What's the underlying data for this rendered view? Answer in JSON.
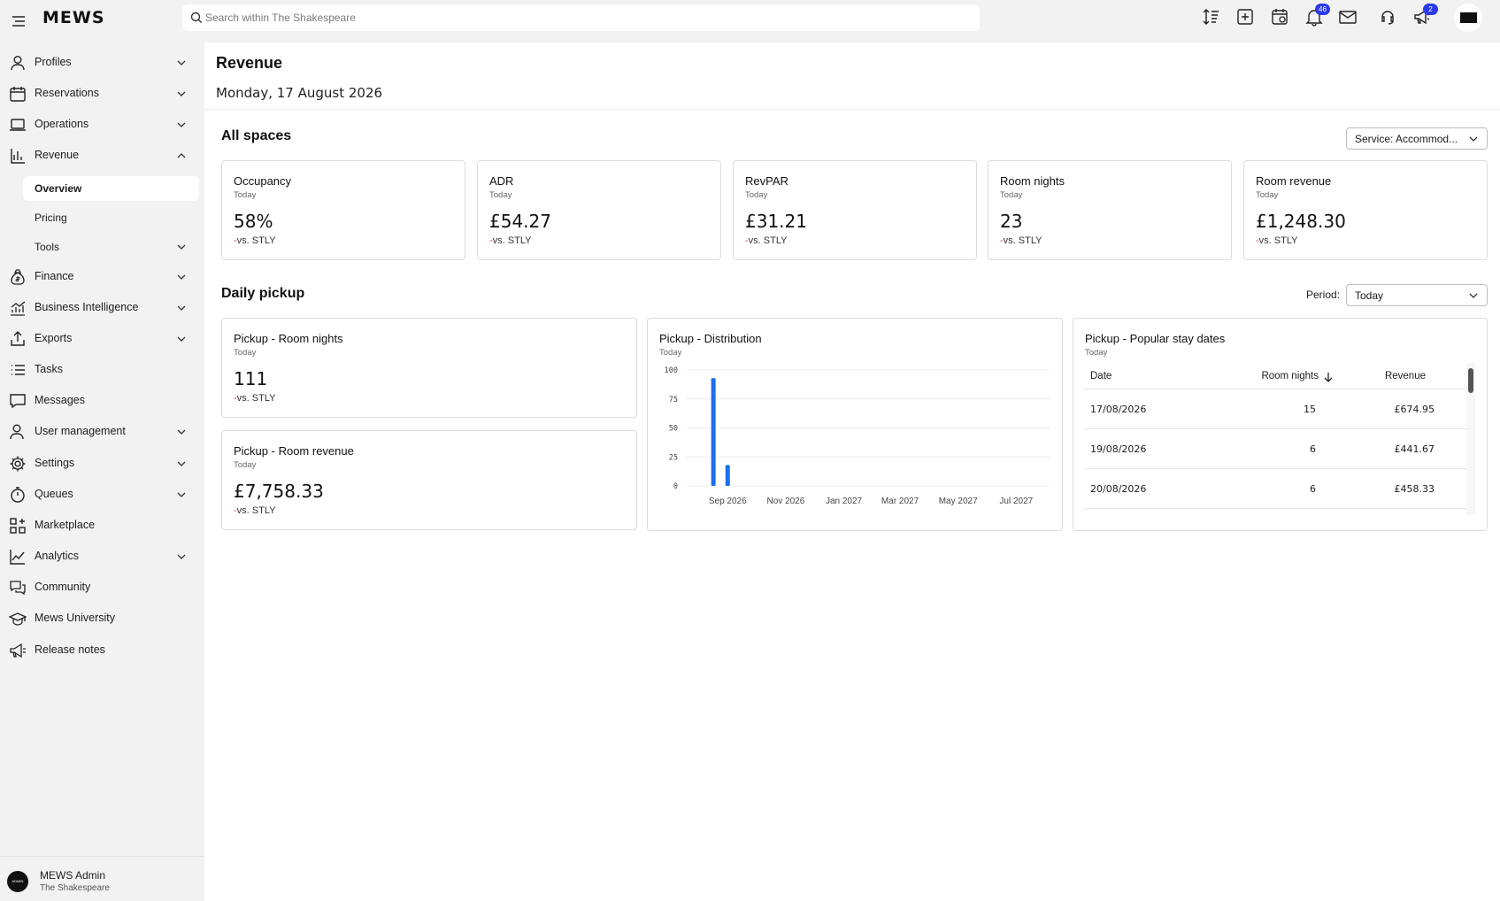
{
  "topbar": {
    "logo": "MEWS",
    "search_placeholder": "Search within The Shakespeare",
    "notifications_count": "46",
    "announcements_count": "2"
  },
  "sidebar": {
    "items": [
      {
        "label": "Profiles",
        "icon": "user-icon"
      },
      {
        "label": "Reservations",
        "icon": "calendar-icon"
      },
      {
        "label": "Operations",
        "icon": "laptop-icon"
      },
      {
        "label": "Revenue",
        "icon": "bar-chart-icon"
      },
      {
        "label": "Finance",
        "icon": "money-bag-icon"
      },
      {
        "label": "Business Intelligence",
        "icon": "trend-icon"
      },
      {
        "label": "Exports",
        "icon": "export-icon"
      },
      {
        "label": "Tasks",
        "icon": "list-icon"
      },
      {
        "label": "Messages",
        "icon": "message-icon"
      },
      {
        "label": "User management",
        "icon": "user-manage-icon"
      },
      {
        "label": "Settings",
        "icon": "gear-icon"
      },
      {
        "label": "Queues",
        "icon": "stopwatch-icon"
      },
      {
        "label": "Marketplace",
        "icon": "grid-plus-icon"
      },
      {
        "label": "Analytics",
        "icon": "line-chart-icon"
      },
      {
        "label": "Community",
        "icon": "chat-bubbles-icon"
      },
      {
        "label": "Mews University",
        "icon": "graduation-cap-icon"
      },
      {
        "label": "Release notes",
        "icon": "megaphone-icon"
      }
    ],
    "revenue_sub": [
      "Overview",
      "Pricing",
      "Tools"
    ],
    "user": {
      "name": "MEWS Admin",
      "org": "The Shakespeare",
      "avatar_text": "ADMIN"
    }
  },
  "main": {
    "title": "Revenue",
    "date": "Monday, 17 August 2026",
    "all_spaces": {
      "title": "All spaces",
      "service_select": "Service: Accommod...",
      "cards": [
        {
          "title": "Occupancy",
          "sub": "Today",
          "value": "58%",
          "vs": "vs. STLY"
        },
        {
          "title": "ADR",
          "sub": "Today",
          "value": "£54.27",
          "vs": "vs. STLY"
        },
        {
          "title": "RevPAR",
          "sub": "Today",
          "value": "£31.21",
          "vs": "vs. STLY"
        },
        {
          "title": "Room nights",
          "sub": "Today",
          "value": "23",
          "vs": "vs. STLY"
        },
        {
          "title": "Room revenue",
          "sub": "Today",
          "value": "£1,248.30",
          "vs": "vs. STLY"
        }
      ]
    },
    "daily_pickup": {
      "title": "Daily pickup",
      "period_label": "Period:",
      "period_value": "Today",
      "room_nights": {
        "title": "Pickup - Room nights",
        "sub": "Today",
        "value": "111",
        "vs": "vs. STLY"
      },
      "room_revenue": {
        "title": "Pickup - Room revenue",
        "sub": "Today",
        "value": "£7,758.33",
        "vs": "vs. STLY"
      },
      "distribution": {
        "title": "Pickup - Distribution",
        "sub": "Today"
      },
      "popular": {
        "title": "Pickup - Popular stay dates",
        "sub": "Today",
        "headers": {
          "date": "Date",
          "nights": "Room nights",
          "revenue": "Revenue"
        },
        "rows": [
          {
            "date": "17/08/2026",
            "nights": "15",
            "revenue": "£674.95"
          },
          {
            "date": "19/08/2026",
            "nights": "6",
            "revenue": "£441.67"
          },
          {
            "date": "20/08/2026",
            "nights": "6",
            "revenue": "£458.33"
          }
        ]
      }
    }
  },
  "chart_data": {
    "type": "bar",
    "title": "Pickup - Distribution",
    "subtitle": "Today",
    "x_ticks": [
      "Sep 2026",
      "Nov 2026",
      "Jan 2027",
      "Mar 2027",
      "May 2027",
      "Jul 2027"
    ],
    "y_ticks": [
      0,
      25,
      50,
      75,
      100
    ],
    "ylim": [
      0,
      100
    ],
    "bars": [
      {
        "x": "2026-08-17",
        "value": 93
      },
      {
        "x": "2026-09-01",
        "value": 18
      }
    ],
    "grid": true,
    "bar_color": "#1a6ff0"
  }
}
